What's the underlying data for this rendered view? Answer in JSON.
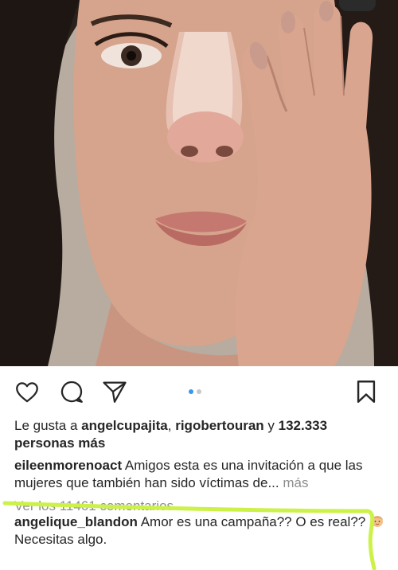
{
  "post": {
    "photo_description_icon": "photo",
    "carousel": {
      "count": 2,
      "active_index": 0
    }
  },
  "actions": {
    "like_icon": "heart-icon",
    "comment_icon": "comment-icon",
    "share_icon": "paper-plane-icon",
    "save_icon": "bookmark-icon"
  },
  "likes": {
    "prefix": "Le gusta a ",
    "user1": "angelcupajita",
    "sep": ", ",
    "user2": "rigobertouran",
    "and": " y ",
    "count": "132.333",
    "suffix": "personas más"
  },
  "caption": {
    "user": "eileenmorenoact",
    "text": " Amigos esta es una invitación a que las mujeres que también han sido víctimas de",
    "ellipsis": "...",
    "more": " más"
  },
  "view_comments": "Ver los 11461 comentarios",
  "comment": {
    "user": "angelique_blandon",
    "text1": " Amor es una campaña?? O es real?? ",
    "emoji": "baby-emoji",
    "text2": " Necesitas algo."
  },
  "colors": {
    "accent_dot": "#3897f0",
    "marker": "#ccf24a",
    "muted": "#8e8e8e"
  }
}
